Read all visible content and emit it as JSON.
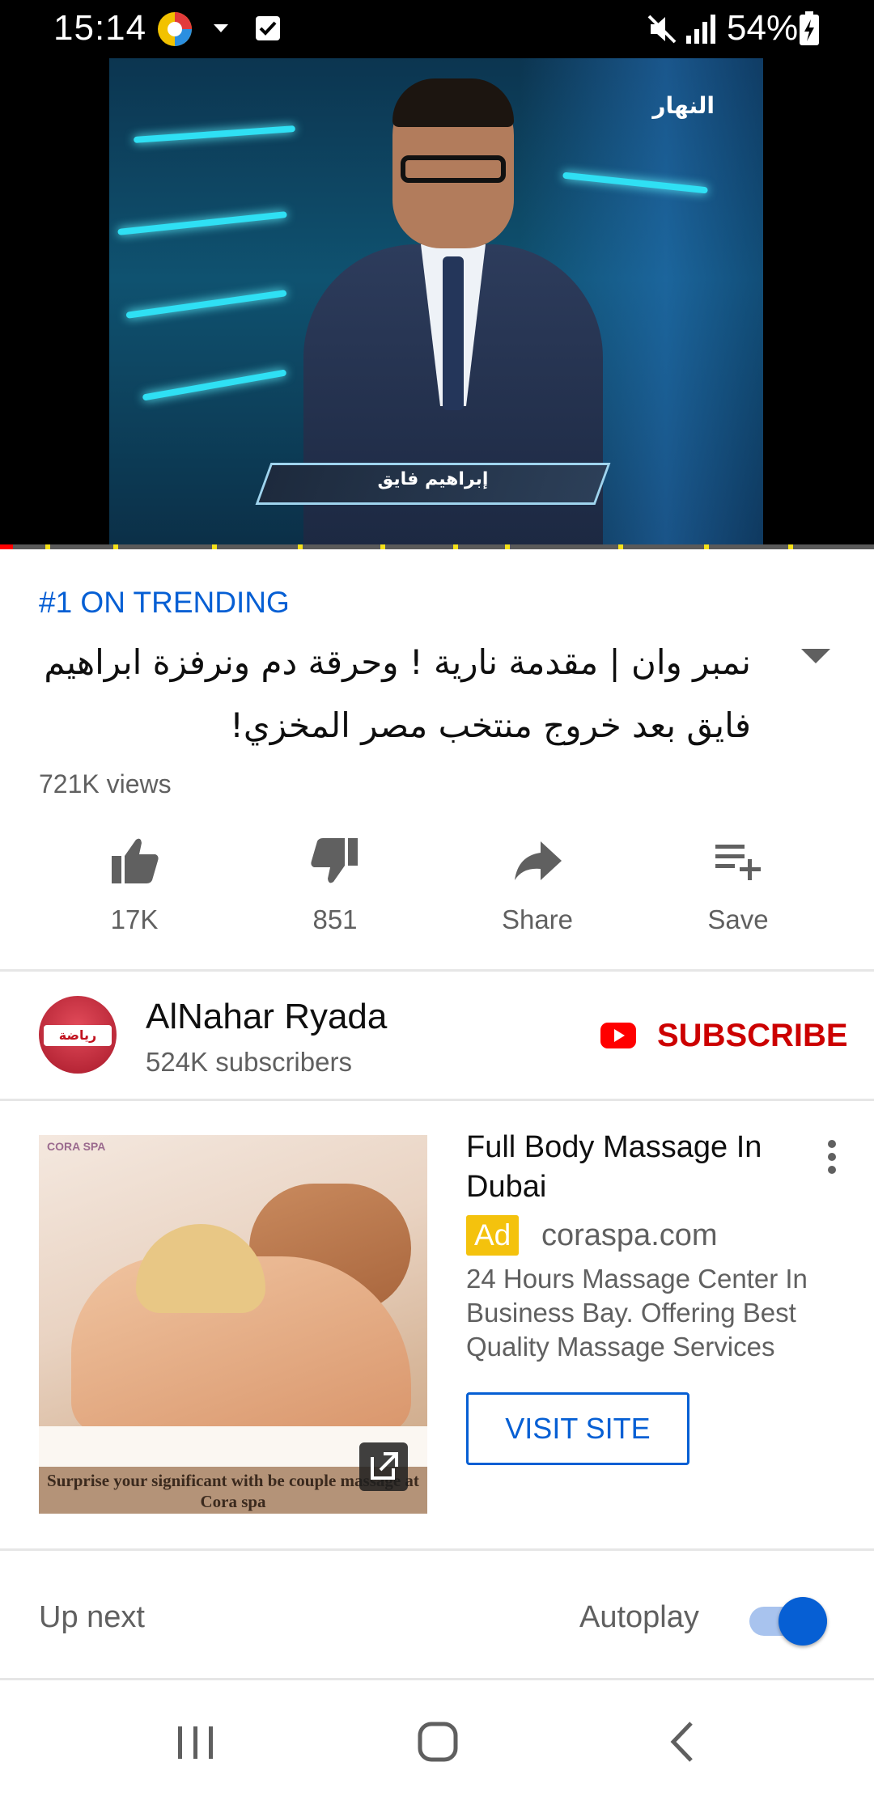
{
  "status_bar": {
    "time": "15:14",
    "battery_percent": "54%",
    "icons": [
      "app-notification-icon",
      "dropdown-arrow-icon",
      "checkbox-icon",
      "mute-icon",
      "signal-icon",
      "battery-charging-icon"
    ]
  },
  "player": {
    "lower_third_text": "إبراهيم فايق",
    "channel_watermark": "النهار",
    "progress_fraction": 0.015,
    "accent_color": "#ff0000"
  },
  "video": {
    "badge": "#1 ON TRENDING",
    "title": "نمبر وان | مقدمة نارية ! وحرقة دم ونرفزة ابراهيم فايق بعد خروج منتخب مصر المخزي!",
    "views": "721K views"
  },
  "actions": {
    "like": {
      "label": "17K",
      "icon": "thumbs-up-icon"
    },
    "dislike": {
      "label": "851",
      "icon": "thumbs-down-icon"
    },
    "share": {
      "label": "Share",
      "icon": "share-icon"
    },
    "save": {
      "label": "Save",
      "icon": "playlist-add-icon"
    }
  },
  "channel": {
    "name": "AlNahar Ryada",
    "subscribers": "524K subscribers",
    "avatar_text": "رياضة",
    "subscribe_label": "SUBSCRIBE",
    "subscribe_color": "#cc0000"
  },
  "ad": {
    "image_caption": "Surprise your significant with be couple massage at Cora spa",
    "image_brand": "CORA SPA",
    "title": "Full Body Massage In Dubai",
    "badge": "Ad",
    "domain": "coraspa.com",
    "description": "24 Hours Massage Center In Business Bay. Offering Best Quality Massage Services",
    "cta": "VISIT SITE",
    "badge_color": "#f4c20d"
  },
  "up_next": {
    "label": "Up next",
    "autoplay_label": "Autoplay",
    "autoplay_on": true,
    "accent_color": "#065fd4"
  },
  "nav_bar": {
    "buttons": [
      "recent-apps-icon",
      "home-icon",
      "back-icon"
    ]
  }
}
